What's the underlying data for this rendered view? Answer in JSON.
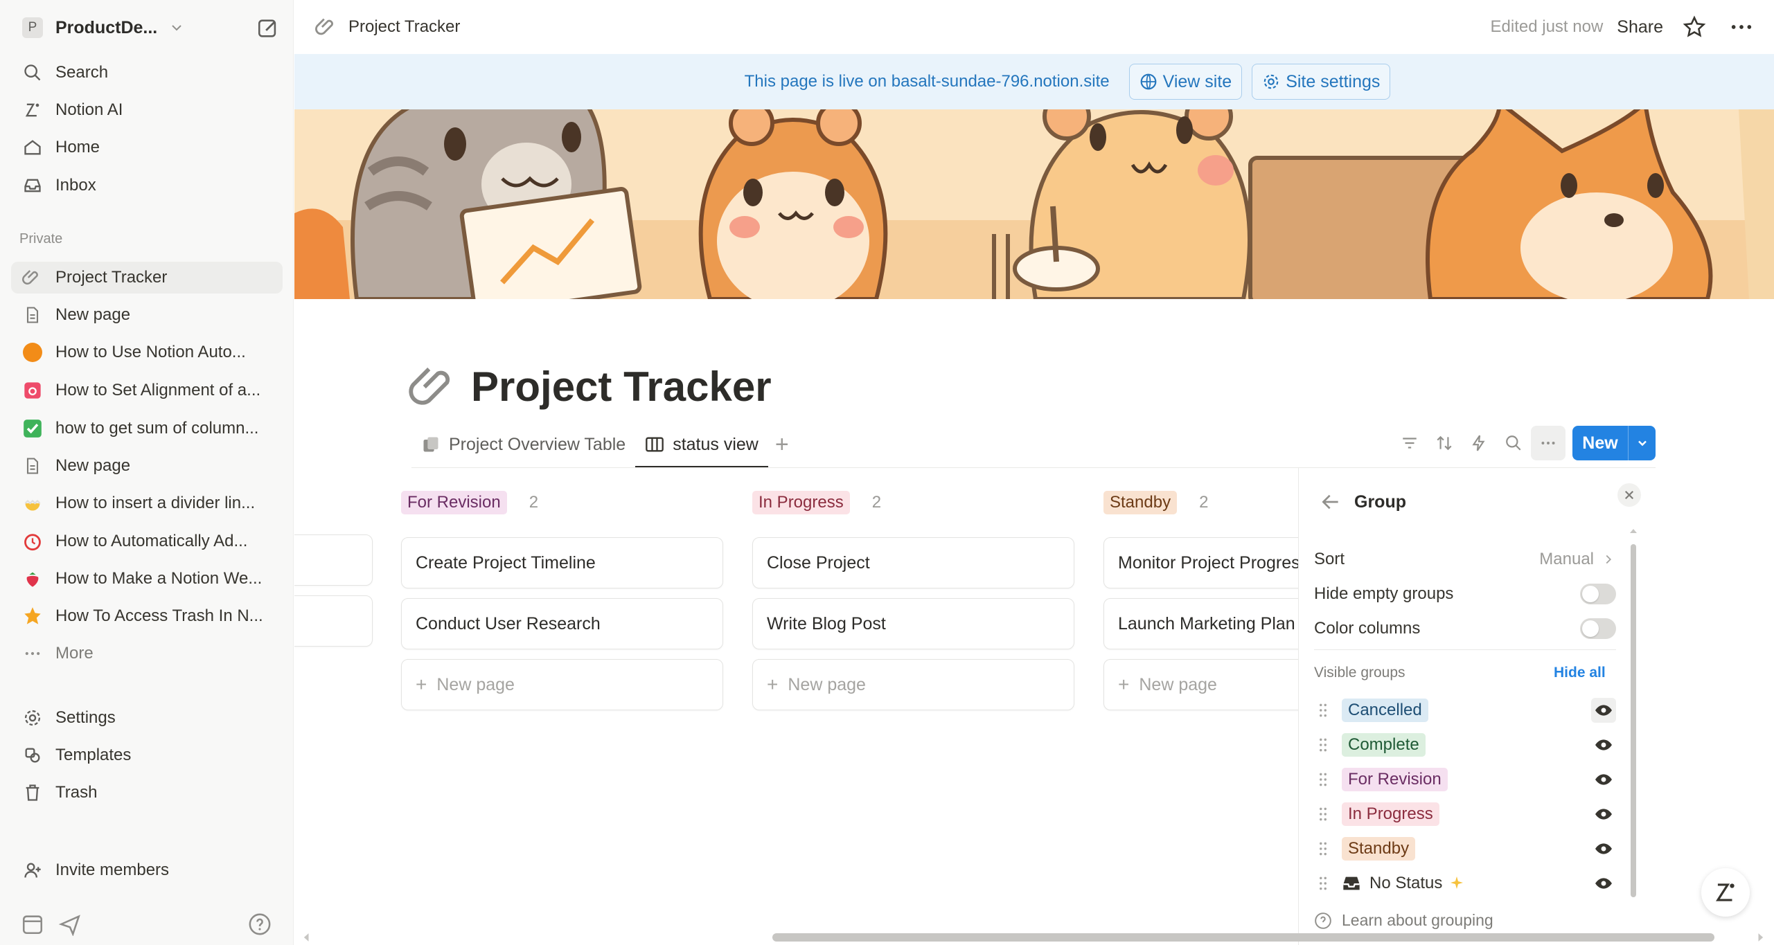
{
  "sidebar": {
    "workspace_initial": "P",
    "workspace_name": "ProductDe...",
    "nav": [
      {
        "label": "Search",
        "icon": "search-icon"
      },
      {
        "label": "Notion AI",
        "icon": "notion-ai-icon"
      },
      {
        "label": "Home",
        "icon": "home-icon"
      },
      {
        "label": "Inbox",
        "icon": "inbox-icon"
      }
    ],
    "section_label": "Private",
    "pages": [
      {
        "label": "Project Tracker",
        "icon": "paperclip-icon",
        "active": true
      },
      {
        "label": "New page",
        "icon": "page-icon"
      },
      {
        "label": "How to Use Notion Auto...",
        "icon": "orange-circle-icon"
      },
      {
        "label": "How to Set Alignment of a...",
        "icon": "pink-square-icon"
      },
      {
        "label": "how to get sum of column...",
        "icon": "green-check-icon"
      },
      {
        "label": "New page",
        "icon": "page-icon"
      },
      {
        "label": "How to insert a divider lin...",
        "icon": "chick-icon"
      },
      {
        "label": "How to Automatically Ad...",
        "icon": "alarm-clock-icon"
      },
      {
        "label": "How to Make a Notion We...",
        "icon": "strawberry-icon"
      },
      {
        "label": "How To Access Trash In N...",
        "icon": "star-burst-icon"
      },
      {
        "label": "More",
        "icon": "ellipsis-icon"
      }
    ],
    "footer_nav": [
      {
        "label": "Settings",
        "icon": "gear-icon"
      },
      {
        "label": "Templates",
        "icon": "templates-icon"
      },
      {
        "label": "Trash",
        "icon": "trash-icon"
      }
    ],
    "invite_label": "Invite members"
  },
  "topbar": {
    "title": "Project Tracker",
    "edited": "Edited just now",
    "share": "Share"
  },
  "banner": {
    "text": "This page is live on basalt-sundae-796.notion.site",
    "view_site": "View site",
    "site_settings": "Site settings"
  },
  "page": {
    "title": "Project Tracker",
    "tabs": [
      {
        "label": "Project Overview Table"
      },
      {
        "label": "status view",
        "active": true
      }
    ],
    "new_button": "New"
  },
  "board": {
    "columns": [
      {
        "status": "For Revision",
        "count": "2",
        "bg": "#f5e0f0",
        "fg": "#6a2d63",
        "cards": [
          "Create Project Timeline",
          "Conduct User Research"
        ]
      },
      {
        "status": "In Progress",
        "count": "2",
        "bg": "#fbe2e6",
        "fg": "#8b2c3e",
        "cards": [
          "Close Project",
          "Write Blog Post"
        ]
      },
      {
        "status": "Standby",
        "count": "2",
        "bg": "#f9e2d0",
        "fg": "#6d3b16",
        "cards": [
          "Monitor Project Progress",
          "Launch Marketing Plan"
        ]
      }
    ],
    "new_page_label": "New page"
  },
  "group_panel": {
    "title": "Group",
    "sort_label": "Sort",
    "sort_value": "Manual",
    "hide_empty_label": "Hide empty groups",
    "hide_empty_on": false,
    "color_columns_label": "Color columns",
    "color_columns_on": false,
    "visible_groups_label": "Visible groups",
    "hide_all_label": "Hide all",
    "groups": [
      {
        "label": "Cancelled",
        "bg": "#dbeaf4",
        "fg": "#1e4e74"
      },
      {
        "label": "Complete",
        "bg": "#dcefdf",
        "fg": "#1f5a35"
      },
      {
        "label": "For Revision",
        "bg": "#f5e0f0",
        "fg": "#6a2d63"
      },
      {
        "label": "In Progress",
        "bg": "#fbe2e6",
        "fg": "#8b2c3e"
      },
      {
        "label": "Standby",
        "bg": "#f9e2d0",
        "fg": "#6d3b16"
      },
      {
        "label": "No Status",
        "bg": "transparent",
        "fg": "#37352f"
      }
    ],
    "learn_label": "Learn about grouping"
  },
  "colors": {
    "accent": "#2383e2",
    "banner_bg": "#e9f3fb",
    "banner_text": "#2476bd"
  }
}
